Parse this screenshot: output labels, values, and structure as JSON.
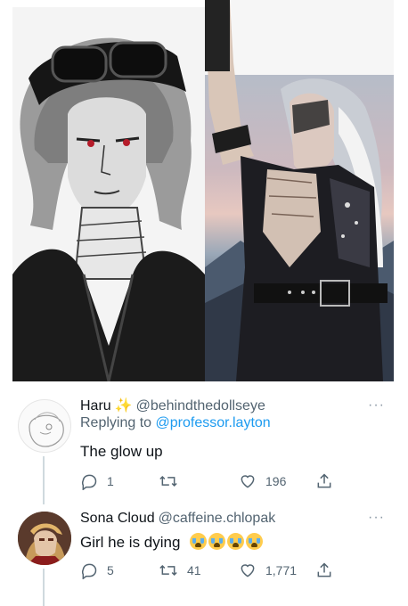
{
  "artwork": {
    "left_alt": "sketch",
    "right_alt": "painting"
  },
  "tweets": [
    {
      "name": "Haru",
      "sparkle": "✨",
      "handle": "@behindthedollseye",
      "replying_label": "Replying to",
      "replying_to": "@professor.layton",
      "text": "The glow up",
      "reply_count": "1",
      "retweet_count": "",
      "like_count": "196"
    },
    {
      "name": "Sona Cloud",
      "handle": "@caffeine.chlopak",
      "text": "Girl he is dying",
      "reply_count": "5",
      "retweet_count": "41",
      "like_count": "1,771"
    }
  ],
  "more_glyph": "···"
}
